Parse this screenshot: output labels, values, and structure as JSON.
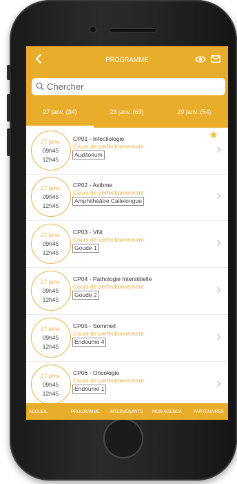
{
  "header": {
    "title": "PROGRAMME",
    "back_icon": "chevron-left-icon",
    "eye_icon": "eye-icon",
    "mail_icon": "mail-icon",
    "bar_color": "#e9ad2c"
  },
  "search": {
    "placeholder": "Chercher",
    "icon": "search-icon"
  },
  "tabs": [
    {
      "label": "27 janv. (34)",
      "active": true
    },
    {
      "label": "28 janv. (69)",
      "active": false
    },
    {
      "label": "29 janv. (54)",
      "active": false
    }
  ],
  "items": [
    {
      "date": "27 janv.",
      "start": "09h45",
      "end": "12h45",
      "title": "CP01 - Infectiologie",
      "type": "Cours de perfectionnement",
      "room": "Auditorium",
      "starred": true
    },
    {
      "date": "27 janv.",
      "start": "09h45",
      "end": "12h45",
      "title": "CP02 - Asthme",
      "type": "Cours de perfectionnement",
      "room": "Amphithéâtre Callelongue",
      "starred": false
    },
    {
      "date": "27 janv.",
      "start": "09h45",
      "end": "12h45",
      "title": "CP03 - VNI",
      "type": "Cours de perfectionnement",
      "room": "Goude 1",
      "starred": false
    },
    {
      "date": "27 janv.",
      "start": "09h45",
      "end": "12h45",
      "title": "CP04 - Pathologie Interstitielle",
      "type": "Cours de perfectionnement",
      "room": "Goude 2",
      "starred": false
    },
    {
      "date": "27 janv.",
      "start": "09h45",
      "end": "12h45",
      "title": "CP05 - Sommeil",
      "type": "Cours de perfectionnement",
      "room": "Endoume 4",
      "starred": false
    },
    {
      "date": "27 janv.",
      "start": "09h45",
      "end": "12h45",
      "title": "CP06 - Oncologie",
      "type": "Cours de perfectionnement",
      "room": "Endoume 1",
      "starred": false
    }
  ],
  "bottom_nav": [
    {
      "label": "ACCUEIL"
    },
    {
      "label": "PROGRAMME"
    },
    {
      "label": "INTERVENANTS"
    },
    {
      "label": "MON AGENDA"
    },
    {
      "label": "PARTENAIRES"
    }
  ],
  "colors": {
    "accent": "#e9ad2c",
    "date_gold": "#e6b24a",
    "star": "#f3c13a"
  }
}
